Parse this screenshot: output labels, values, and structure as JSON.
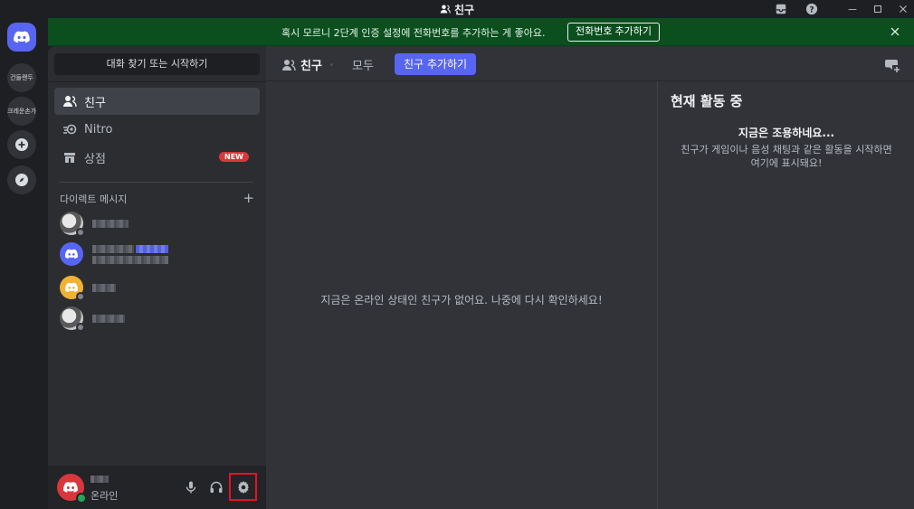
{
  "window": {
    "title": "친구"
  },
  "rail": {
    "servers": [
      {
        "label": "건들랜두"
      },
      {
        "label": "크레운손가"
      }
    ]
  },
  "banner": {
    "message": "혹시 모르니 2단계 인증 설정에 전화번호를 추가하는 게 좋아요.",
    "cta": "전화번호 추가하기"
  },
  "sidebar": {
    "search_label": "대화 찾기 또는 시작하기",
    "nav": [
      {
        "label": "친구",
        "icon": "friends-icon"
      },
      {
        "label": "Nitro",
        "icon": "nitro-icon"
      },
      {
        "label": "상점",
        "icon": "shop-icon",
        "badge": "NEW"
      }
    ],
    "dm_header": "다이렉트 메시지",
    "dm_add": "+",
    "dms": [
      {
        "avatar": "anime-avatar",
        "status": "offline"
      },
      {
        "avatar": "discord-blue-avatar",
        "status": "none"
      },
      {
        "avatar": "discord-yellow-avatar",
        "status": "offline"
      },
      {
        "avatar": "anime-avatar",
        "status": "offline"
      }
    ]
  },
  "user_panel": {
    "status": "온라인",
    "colors": {
      "avatar": "#da373c",
      "online": "#23a55a"
    }
  },
  "main": {
    "header": {
      "friends_label": "친구",
      "tab_all": "모두",
      "add_friend": "친구 추가하기"
    },
    "empty_message": "지금은 온라인 상태인 친구가 없어요. 나중에 다시 확인하세요!",
    "activity": {
      "title": "현재 활동 중",
      "quiet_title": "지금은 조용하네요...",
      "quiet_desc": "친구가 게임이나 음성 채팅과 같은 활동을 시작하면 여기에 표시돼요!"
    }
  },
  "colors": {
    "blurple": "#5865f2",
    "banner_green": "#0b4f1f",
    "highlight_red": "#e81123"
  }
}
